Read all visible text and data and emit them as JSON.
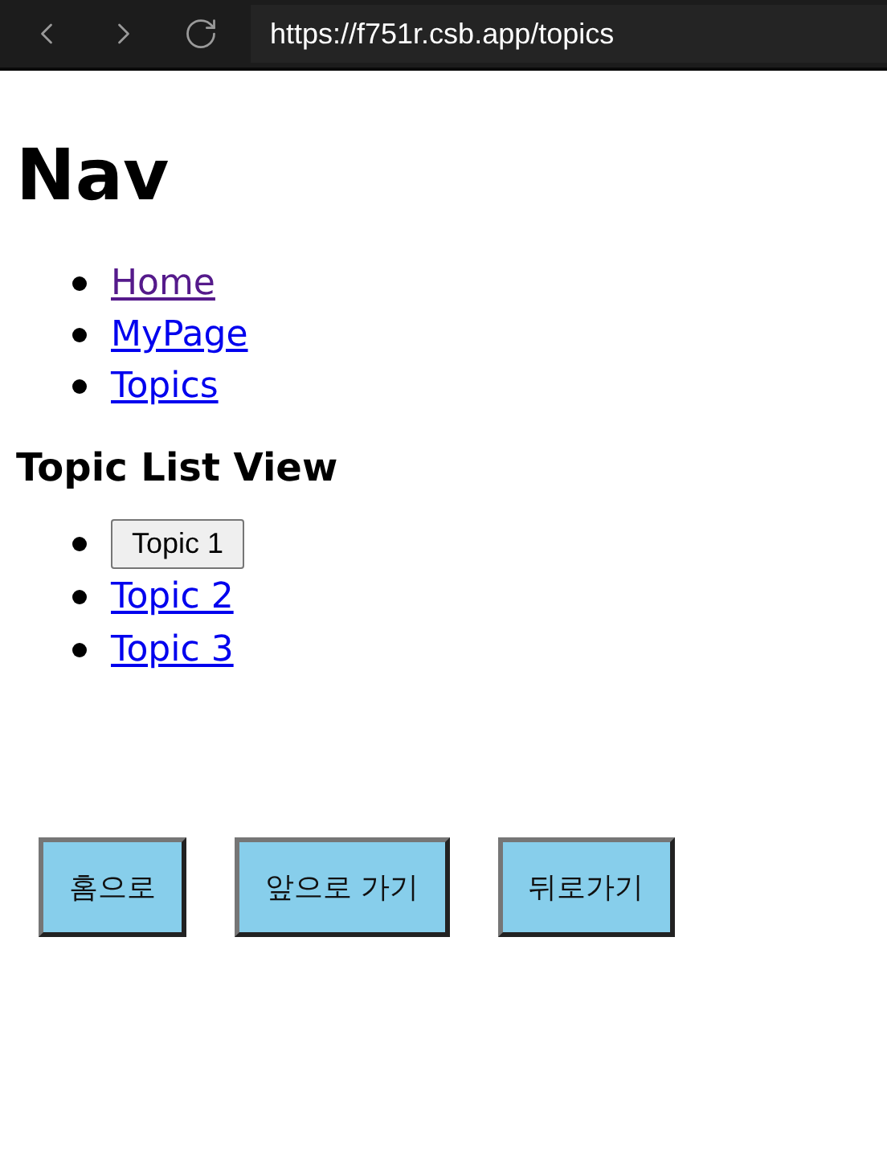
{
  "browser": {
    "url": "https://f751r.csb.app/topics"
  },
  "title": "Nav",
  "nav_links": [
    {
      "label": "Home",
      "visited": true
    },
    {
      "label": "MyPage",
      "visited": false
    },
    {
      "label": "Topics",
      "visited": false
    }
  ],
  "topics": {
    "heading": "Topic List View",
    "items": [
      {
        "kind": "button",
        "label": "Topic 1"
      },
      {
        "kind": "link",
        "label": "Topic 2"
      },
      {
        "kind": "link",
        "label": "Topic 3"
      }
    ]
  },
  "buttons": [
    "홈으로",
    "앞으로 가기",
    "뒤로가기"
  ]
}
